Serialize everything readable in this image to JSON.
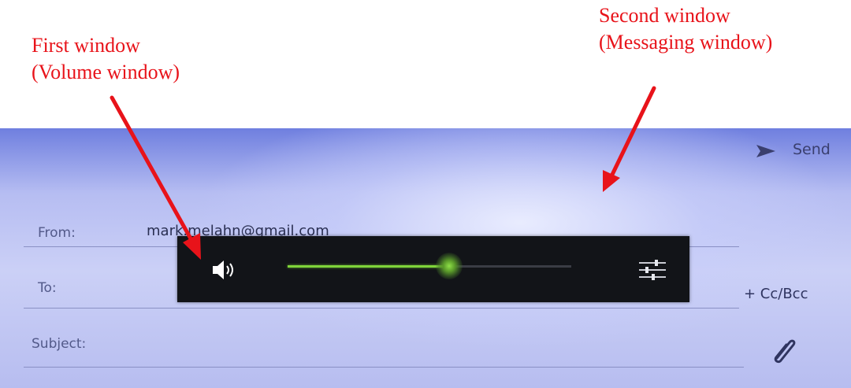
{
  "annotations": {
    "first_window_line1": "First window",
    "first_window_line2": "(Volume window)",
    "second_window_line1": "Second window",
    "second_window_line2": "(Messaging window)"
  },
  "compose": {
    "send_label": "Send",
    "from_label": "From:",
    "from_value": "mark.melahn@gmail.com",
    "to_label": "To:",
    "subject_label": "Subject:",
    "cc_bcc_label": "+ Cc/Bcc",
    "send_icon": "send-arrow-icon",
    "attach_icon": "paperclip-icon"
  },
  "volume": {
    "level": 0.57,
    "speaker_icon": "speaker-icon",
    "settings_icon": "sliders-settings-icon",
    "accent_color": "#7fd43a"
  },
  "colors": {
    "annotation": "#e8131a",
    "panel_bg": "#121418"
  }
}
